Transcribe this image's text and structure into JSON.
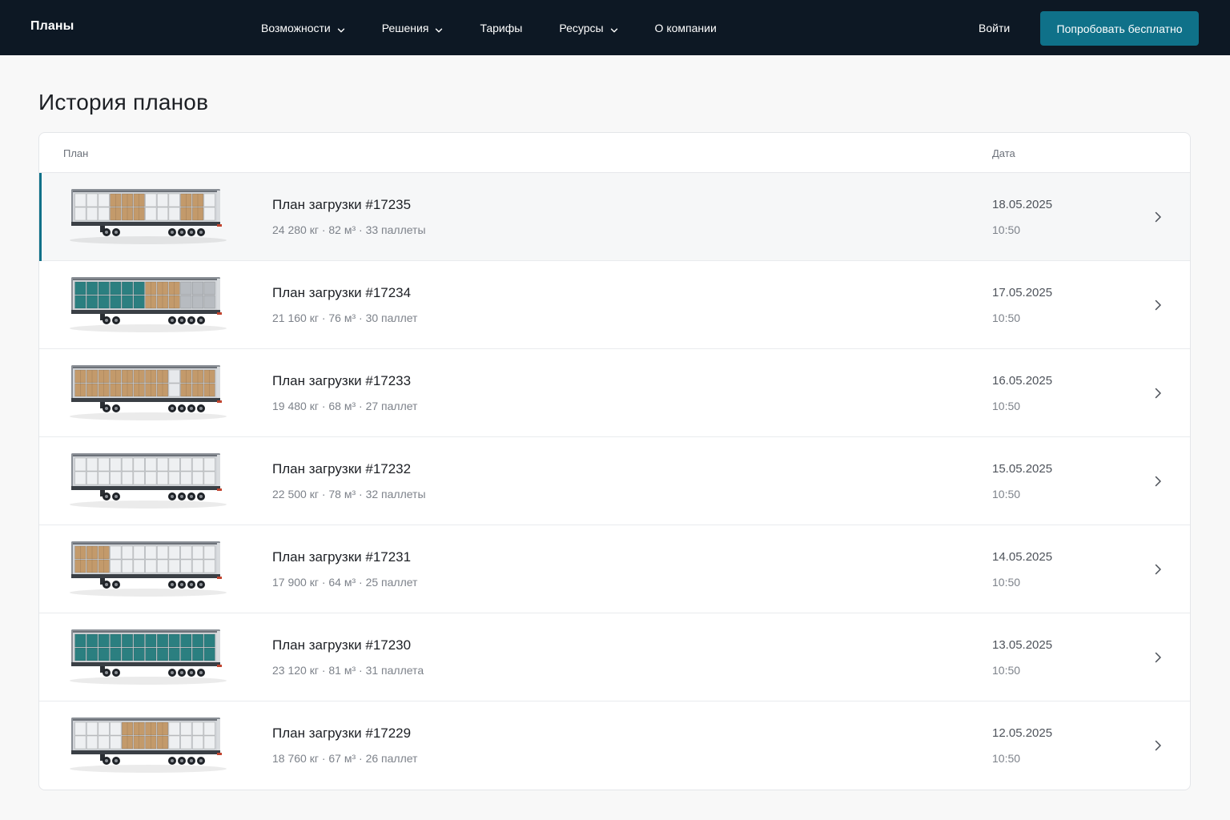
{
  "header": {
    "brand": "Планы",
    "nav": [
      {
        "label": "Возможности",
        "dropdown": true
      },
      {
        "label": "Решения",
        "dropdown": true
      },
      {
        "label": "Тарифы",
        "dropdown": false
      },
      {
        "label": "Ресурсы",
        "dropdown": true
      },
      {
        "label": "О компании",
        "dropdown": false
      }
    ],
    "login": "Войти",
    "cta": "Попробовать бесплатно"
  },
  "page": {
    "title": "История планов",
    "columns": {
      "plan": "План",
      "date": "Дата"
    }
  },
  "colors": {
    "header_bg": "#0d1824",
    "accent": "#0f7189",
    "cargo_box": "#c39a6b",
    "cargo_white": "#eef0f2",
    "cargo_teal": "#2b7f80",
    "cargo_gray": "#b7bbc0"
  },
  "plans": [
    {
      "name": "План загрузки #17235",
      "meta": "24 280 кг · 82 м³ · 33 паллеты",
      "date": "18.05.2025",
      "time": "10:50",
      "active": true,
      "cargo": [
        "white",
        "white",
        "white",
        "box",
        "box",
        "box",
        "white",
        "white",
        "white",
        "box",
        "box",
        "white"
      ]
    },
    {
      "name": "План загрузки #17234",
      "meta": "21 160 кг · 76 м³ · 30 паллет",
      "date": "17.05.2025",
      "time": "10:50",
      "active": false,
      "cargo": [
        "teal",
        "teal",
        "teal",
        "teal",
        "teal",
        "teal",
        "box",
        "box",
        "box",
        "gray",
        "gray",
        "gray"
      ]
    },
    {
      "name": "План загрузки #17233",
      "meta": "19 480 кг · 68 м³ · 27 паллет",
      "date": "16.05.2025",
      "time": "10:50",
      "active": false,
      "cargo": [
        "box",
        "box",
        "box",
        "box",
        "box",
        "box",
        "box",
        "box",
        "empty",
        "box",
        "box",
        "box"
      ]
    },
    {
      "name": "План загрузки #17232",
      "meta": "22 500 кг · 78 м³ · 32 паллеты",
      "date": "15.05.2025",
      "time": "10:50",
      "active": false,
      "cargo": [
        "white",
        "white",
        "white",
        "white",
        "white",
        "white",
        "white",
        "white",
        "white",
        "white",
        "white",
        "white"
      ]
    },
    {
      "name": "План загрузки #17231",
      "meta": "17 900 кг · 64 м³ · 25 паллет",
      "date": "14.05.2025",
      "time": "10:50",
      "active": false,
      "cargo": [
        "box",
        "box",
        "box",
        "white",
        "white",
        "white",
        "white",
        "white",
        "white",
        "white",
        "white",
        "white"
      ]
    },
    {
      "name": "План загрузки #17230",
      "meta": "23 120 кг · 81 м³ · 31 паллета",
      "date": "13.05.2025",
      "time": "10:50",
      "active": false,
      "cargo": [
        "teal",
        "teal",
        "teal",
        "teal",
        "teal",
        "teal",
        "teal",
        "teal",
        "teal",
        "teal",
        "teal",
        "teal"
      ]
    },
    {
      "name": "План загрузки #17229",
      "meta": "18 760 кг · 67 м³ · 26 паллет",
      "date": "12.05.2025",
      "time": "10:50",
      "active": false,
      "cargo": [
        "white",
        "white",
        "white",
        "white",
        "box",
        "box",
        "box",
        "box",
        "white",
        "white",
        "white",
        "white"
      ]
    }
  ]
}
